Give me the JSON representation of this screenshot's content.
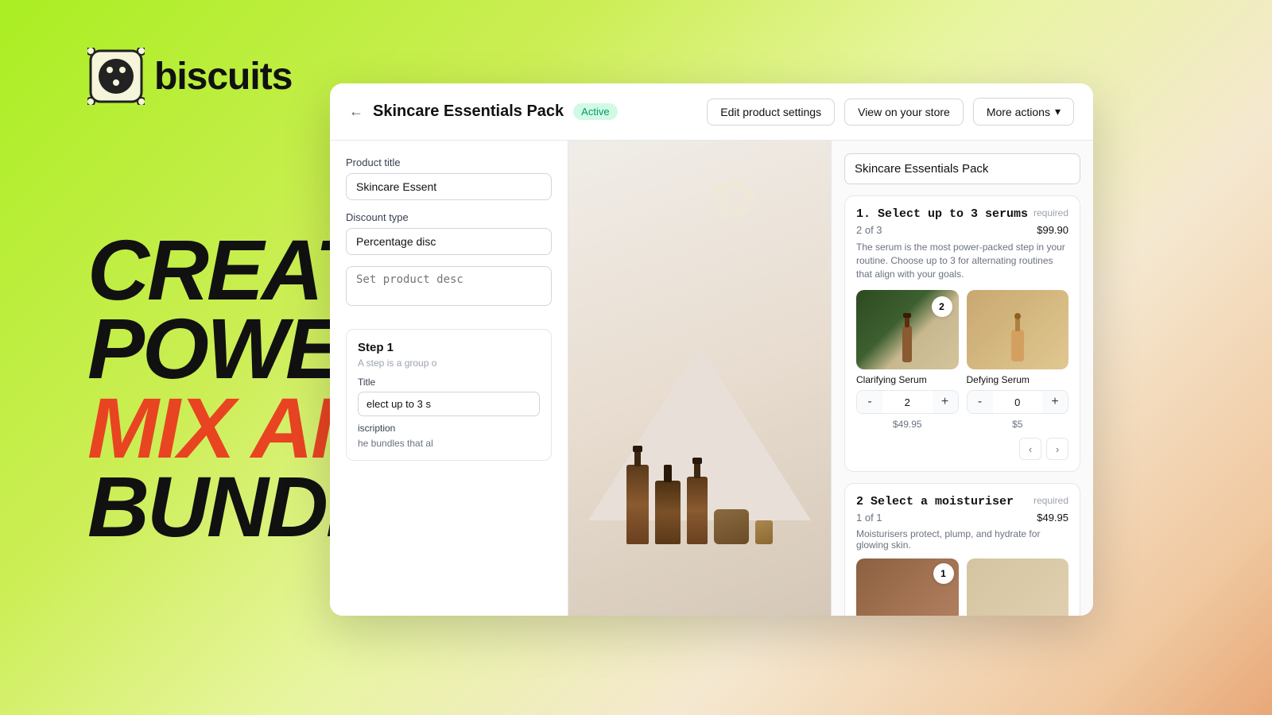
{
  "brand": {
    "name": "biscuits",
    "logo_alt": "Biscuits logo"
  },
  "hero": {
    "line1": "CREATE",
    "line2": "POWERFUL",
    "line3": "MIX AND MATCH",
    "line4": "BUNDLES"
  },
  "card": {
    "header": {
      "back_label": "←",
      "product_name": "Skincare Essentials Pack",
      "status": "Active",
      "edit_settings_label": "Edit product settings",
      "view_store_label": "View on your store",
      "more_actions_label": "More actions",
      "chevron": "▾"
    },
    "left_panel": {
      "product_title_label": "Product title",
      "product_title_value": "Skincare Essent",
      "discount_type_label": "Discount type",
      "discount_type_value": "Percentage disc",
      "description_placeholder": "Set product desc",
      "step_section": {
        "title": "Step 1",
        "description": "A step is a group o",
        "title_label": "Title",
        "title_value": "elect up to 3 s",
        "description_label": "iscription",
        "desc_note": "he bundles that al"
      }
    },
    "right_panel": {
      "bundle_title": "Skincare Essentials Pack",
      "step1": {
        "title": "1. Select up to 3 serums",
        "required": "required",
        "count": "2 of 3",
        "price": "$99.90",
        "description": "The serum is the most power-packed step in your routine. Choose up to 3 for alternating routines that align with your goals.",
        "products": [
          {
            "name": "Clarifying Serum",
            "qty": 2,
            "price": "$49.95",
            "badge": "2",
            "img_type": "serum1"
          },
          {
            "name": "Defying Serum",
            "qty": 0,
            "price": "$5",
            "badge": "",
            "img_type": "serum2"
          }
        ]
      },
      "step2": {
        "title": "2 Select a moisturiser",
        "required": "required",
        "count": "1 of 1",
        "price": "$49.95",
        "description": "Moisturisers protect, plump, and hydrate for glowing skin.",
        "products": [
          {
            "img_type": "moisturiser",
            "badge": "1"
          },
          {
            "img_type": "moisturiser2",
            "badge": ""
          }
        ]
      }
    }
  }
}
